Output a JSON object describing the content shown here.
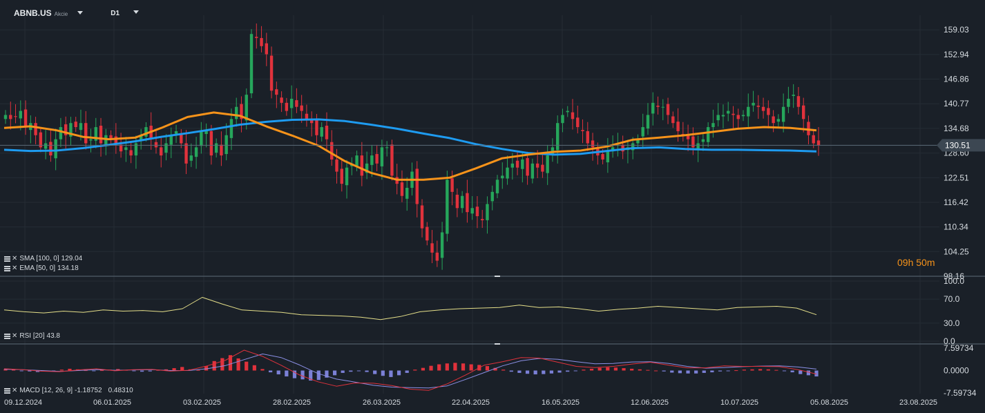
{
  "toolbar": {
    "symbol": "ABNB.US",
    "symbol_type": "Akcie",
    "timeframe": "D1"
  },
  "indicators": {
    "sma": {
      "label": "SMA [100, 0]",
      "value": "129.04",
      "color": "#1e9bf0"
    },
    "ema": {
      "label": "EMA [50, 0]",
      "value": "134.18",
      "color": "#f7931a"
    },
    "rsi": {
      "label": "RSI [20]",
      "value": "43.8",
      "color": "#e6e08a"
    },
    "macd": {
      "label": "MACD [12, 26, 9]",
      "value1": "-1.18752",
      "value2": "0.48310"
    }
  },
  "countdown": {
    "hours": "09",
    "h_unit": "h",
    "minutes": "50",
    "m_unit": "m"
  },
  "colors": {
    "background": "#1a2028",
    "up": "#26a65b",
    "down": "#e0323c",
    "grid": "#252c35",
    "price_line": "#5d6b78",
    "histogram_pos": "#e0323c",
    "histogram_neg": "#7b80d6"
  },
  "chart_data": {
    "type": "candlestick",
    "x_ticks": [
      "09.12.2024",
      "06.01.2025",
      "03.02.2025",
      "28.02.2025",
      "26.03.2025",
      "22.04.2025",
      "16.05.2025",
      "12.06.2025",
      "10.07.2025",
      "05.08.2025",
      "23.08.2025"
    ],
    "price_axis": {
      "ticks": [
        "159.03",
        "152.94",
        "146.86",
        "140.77",
        "134.68",
        "128.60",
        "122.51",
        "116.42",
        "110.34",
        "104.25",
        "98.16"
      ],
      "ylim": [
        98.16,
        162.0
      ]
    },
    "last_price": "130.51",
    "closes": [
      138,
      137,
      137.5,
      139,
      135,
      136,
      133,
      130,
      131,
      128,
      132,
      135,
      133,
      136,
      135,
      136,
      131,
      132,
      135,
      131,
      133,
      132,
      131,
      129,
      130,
      128,
      131,
      133,
      135,
      132,
      130,
      128,
      131,
      133,
      134,
      131,
      126,
      128,
      130,
      134,
      134,
      128,
      131,
      128,
      133,
      137,
      140,
      137,
      143,
      158,
      157,
      155,
      153,
      144,
      143,
      141,
      139,
      142,
      140,
      139,
      137,
      136,
      133,
      135,
      132,
      127,
      124,
      121,
      125,
      126,
      128,
      123,
      126,
      128,
      126,
      130,
      130,
      123,
      121,
      118,
      120,
      124,
      116,
      110,
      107,
      104,
      102,
      109,
      122,
      119,
      115,
      118,
      114,
      115,
      113,
      112,
      116,
      119,
      122,
      123,
      125,
      126,
      125,
      127,
      123,
      126,
      125,
      124,
      128,
      130,
      136,
      138,
      139,
      137,
      135,
      134,
      131,
      130,
      128,
      127,
      129,
      130,
      131,
      129,
      130,
      131,
      132,
      135,
      138,
      141,
      140,
      140,
      138,
      136,
      134,
      133,
      132,
      130,
      131,
      132,
      135,
      136,
      138,
      138,
      139,
      138,
      137,
      138,
      140,
      141,
      140,
      139,
      138,
      136,
      137,
      140,
      142,
      143,
      140,
      137,
      133,
      131,
      130.51
    ],
    "sma": {
      "name": "SMA [100, 0]",
      "values": [
        129.4,
        129.1,
        129.2,
        129.8,
        130.6,
        131.5,
        132.6,
        133.5,
        134.5,
        135.6,
        136.3,
        136.8,
        136.9,
        136.5,
        135.6,
        134.6,
        133.4,
        132.3,
        130.8,
        129.6,
        128.6,
        128.2,
        128.4,
        129.1,
        129.8,
        130.0,
        129.6,
        129.4,
        129.4,
        129.3,
        129.2,
        129.0
      ]
    },
    "ema": {
      "name": "EMA [50, 0]",
      "values": [
        134.8,
        135.2,
        134.2,
        132.6,
        132.0,
        132.4,
        134.8,
        137.5,
        138.6,
        137.8,
        135.2,
        132.9,
        130.4,
        126.6,
        123.7,
        122.0,
        122.0,
        122.5,
        124.8,
        127.3,
        128.2,
        128.9,
        129.2,
        130.2,
        131.9,
        132.4,
        133.0,
        133.8,
        134.6,
        135.0,
        134.8,
        134.2
      ]
    },
    "rsi": {
      "name": "RSI [20]",
      "ylim": [
        0,
        100
      ],
      "ticks": [
        "100.0",
        "70.0",
        "30.0",
        "0.0"
      ],
      "values": [
        52,
        49,
        47,
        50,
        48,
        52,
        50,
        51,
        49,
        54,
        73,
        62,
        52,
        50,
        48,
        44,
        43,
        42,
        40,
        36,
        41,
        49,
        52,
        54,
        55,
        56,
        60,
        56,
        57,
        54,
        50,
        53,
        55,
        58,
        56,
        54,
        52,
        56,
        57,
        58,
        55,
        44
      ]
    },
    "macd": {
      "name": "MACD [12, 26, 9]",
      "ticks": [
        "7.59734",
        "0.0000",
        "-7.59734"
      ],
      "ylim": [
        -7.59734,
        7.59734
      ],
      "histogram": [
        0.5,
        0.3,
        -0.1,
        -0.3,
        -0.5,
        -0.3,
        -0.1,
        0.3,
        0.6,
        0.4,
        0.1,
        -0.1,
        0.1,
        0.3,
        0.5,
        0.2,
        -0.2,
        -0.4,
        -0.3,
        0.2,
        0.4,
        0.8,
        1.2,
        0.4,
        0.2,
        1.5,
        3.2,
        4.2,
        5.2,
        4.1,
        3.0,
        1.8,
        0.5,
        -0.6,
        -1.3,
        -2.0,
        -2.6,
        -3.0,
        -3.4,
        -3.2,
        -2.4,
        -1.6,
        -0.8,
        -0.4,
        -0.2,
        -0.5,
        -1.2,
        -1.8,
        -2.2,
        -1.6,
        -0.8,
        0.3,
        0.9,
        1.6,
        2.1,
        2.4,
        2.6,
        2.4,
        2.1,
        1.9,
        1.5,
        0.9,
        0.3,
        -0.4,
        -0.8,
        -1.1,
        -1.3,
        -1.2,
        -1.0,
        -0.7,
        -0.4,
        -0.1,
        0.3,
        0.6,
        0.9,
        1.1,
        1.0,
        0.8,
        0.6,
        0.4,
        0.2,
        0.0,
        -0.3,
        -0.7,
        -0.9,
        -1.0,
        -1.0,
        -0.8,
        -0.6,
        -0.3,
        -0.1,
        0.1,
        0.3,
        0.4,
        0.5,
        0.4,
        0.2,
        -0.1,
        -0.6,
        -1.2,
        -1.6,
        -2.0
      ],
      "macd_line": [
        0.6,
        0.3,
        -0.2,
        -0.4,
        0.2,
        0.6,
        -0.1,
        0.3,
        0.4,
        -0.2,
        0.1,
        1.6,
        3.5,
        6.9,
        4.8,
        1.8,
        -1.5,
        -3.8,
        -5.3,
        -4.2,
        -4.3,
        -5.1,
        -6.3,
        -6.7,
        -4.5,
        -1.5,
        1.8,
        3.0,
        4.4,
        4.2,
        2.8,
        1.4,
        1.0,
        1.4,
        2.2,
        2.8,
        1.8,
        0.9,
        0.9,
        1.6,
        1.4,
        1.4,
        1.3,
        0.3,
        -1.2
      ],
      "signal_line": [
        0.4,
        0.3,
        0.0,
        -0.3,
        0.0,
        0.3,
        0.1,
        0.2,
        0.3,
        0.0,
        0.0,
        0.6,
        1.7,
        3.7,
        5.6,
        4.4,
        1.9,
        -1.0,
        -2.9,
        -3.9,
        -5.0,
        -5.6,
        -5.8,
        -5.9,
        -5.2,
        -3.0,
        -0.7,
        1.6,
        3.3,
        4.1,
        3.8,
        3.0,
        2.3,
        2.4,
        2.9,
        3.0,
        2.4,
        1.4,
        0.8,
        1.0,
        1.3,
        1.5,
        1.6,
        1.2,
        0.5
      ]
    }
  }
}
